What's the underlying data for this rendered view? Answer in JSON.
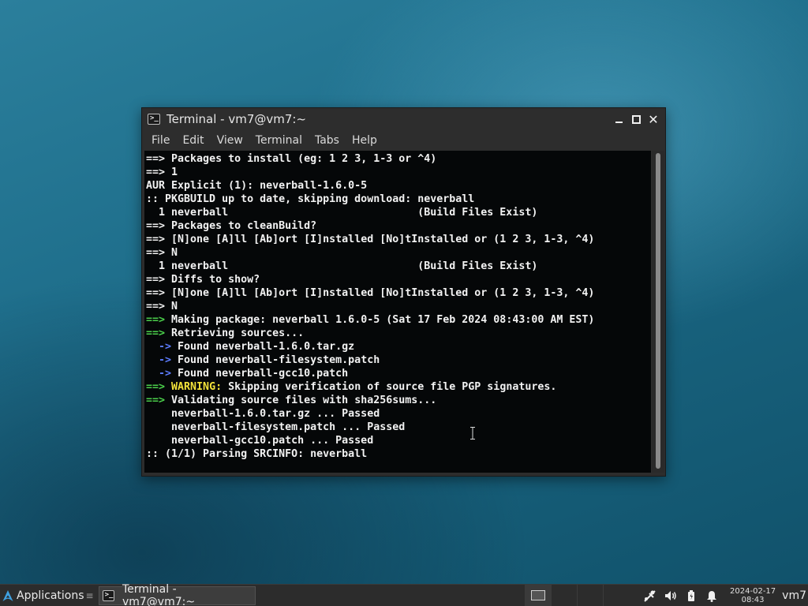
{
  "window": {
    "title": "Terminal - vm7@vm7:~",
    "menu": [
      "File",
      "Edit",
      "View",
      "Terminal",
      "Tabs",
      "Help"
    ]
  },
  "terminal": {
    "lines": [
      [
        {
          "t": "==> ",
          "c": "white"
        },
        {
          "t": "Packages to install (eg: 1 2 3, 1-3 or ^4)",
          "c": "white"
        }
      ],
      [
        {
          "t": "==> ",
          "c": "white"
        },
        {
          "t": "1",
          "c": "white"
        }
      ],
      [
        {
          "t": "AUR Explicit (1): neverball-1.6.0-5",
          "c": "white"
        }
      ],
      [
        {
          "t": ":: PKGBUILD up to date, skipping download: neverball",
          "c": "white"
        }
      ],
      [
        {
          "t": "  1 neverball                              (Build Files Exist)",
          "c": "white"
        }
      ],
      [
        {
          "t": "==> ",
          "c": "white"
        },
        {
          "t": "Packages to cleanBuild?",
          "c": "white"
        }
      ],
      [
        {
          "t": "==> ",
          "c": "white"
        },
        {
          "t": "[N]one [A]ll [Ab]ort [I]nstalled [No]tInstalled or (1 2 3, 1-3, ^4)",
          "c": "white"
        }
      ],
      [
        {
          "t": "==> ",
          "c": "white"
        },
        {
          "t": "N",
          "c": "white"
        }
      ],
      [
        {
          "t": "  1 neverball                              (Build Files Exist)",
          "c": "white"
        }
      ],
      [
        {
          "t": "==> ",
          "c": "white"
        },
        {
          "t": "Diffs to show?",
          "c": "white"
        }
      ],
      [
        {
          "t": "==> ",
          "c": "white"
        },
        {
          "t": "[N]one [A]ll [Ab]ort [I]nstalled [No]tInstalled or (1 2 3, 1-3, ^4)",
          "c": "white"
        }
      ],
      [
        {
          "t": "==> ",
          "c": "white"
        },
        {
          "t": "N",
          "c": "white"
        }
      ],
      [
        {
          "t": "==> ",
          "c": "green"
        },
        {
          "t": "Making package: neverball 1.6.0-5 (Sat 17 Feb 2024 08:43:00 AM EST)",
          "c": "white"
        }
      ],
      [
        {
          "t": "==> ",
          "c": "green"
        },
        {
          "t": "Retrieving sources...",
          "c": "white"
        }
      ],
      [
        {
          "t": "  -> ",
          "c": "blue"
        },
        {
          "t": "Found neverball-1.6.0.tar.gz",
          "c": "white"
        }
      ],
      [
        {
          "t": "  -> ",
          "c": "blue"
        },
        {
          "t": "Found neverball-filesystem.patch",
          "c": "white"
        }
      ],
      [
        {
          "t": "  -> ",
          "c": "blue"
        },
        {
          "t": "Found neverball-gcc10.patch",
          "c": "white"
        }
      ],
      [
        {
          "t": "==> ",
          "c": "green"
        },
        {
          "t": "WARNING:",
          "c": "yellow"
        },
        {
          "t": " Skipping verification of source file PGP signatures.",
          "c": "white"
        }
      ],
      [
        {
          "t": "==> ",
          "c": "green"
        },
        {
          "t": "Validating source files with sha256sums...",
          "c": "white"
        }
      ],
      [
        {
          "t": "    neverball-1.6.0.tar.gz ... Passed",
          "c": "white"
        }
      ],
      [
        {
          "t": "    neverball-filesystem.patch ... Passed",
          "c": "white"
        }
      ],
      [
        {
          "t": "    neverball-gcc10.patch ... Passed",
          "c": "white"
        }
      ],
      [
        {
          "t": ":: (1/1) Parsing SRCINFO: neverball",
          "c": "white"
        }
      ]
    ]
  },
  "taskbar": {
    "applications_label": "Applications",
    "task_label": "Terminal - vm7@vm7:~",
    "date": "2024-02-17",
    "time": "08:43",
    "user": "vm7"
  },
  "icons": {
    "terminal": "terminal-icon",
    "applications": "arch-logo-icon",
    "network": "network-icon",
    "volume": "volume-icon",
    "battery": "battery-icon",
    "notifications": "bell-icon"
  }
}
